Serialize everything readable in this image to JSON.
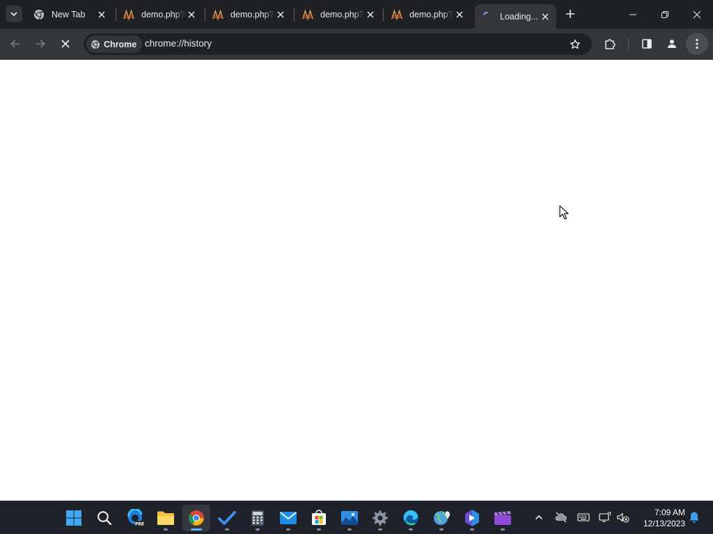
{
  "browser": {
    "tabs": [
      {
        "title": "New Tab",
        "favicon": "chrome-icon",
        "active": false
      },
      {
        "title": "demo.php?",
        "favicon": "opencart-icon",
        "active": false
      },
      {
        "title": "demo.php?",
        "favicon": "opencart-icon",
        "active": false
      },
      {
        "title": "demo.php?",
        "favicon": "opencart-icon",
        "active": false
      },
      {
        "title": "demo.php?",
        "favicon": "opencart-icon",
        "active": false
      },
      {
        "title": "Loading...",
        "favicon": "loading-spinner-icon",
        "active": true
      }
    ],
    "toolbar": {
      "chip_label": "Chrome",
      "url": "chrome://history",
      "reload_state": "stop"
    }
  },
  "taskbar": {
    "apps": [
      {
        "name": "start",
        "icon": "windows-start-icon"
      },
      {
        "name": "search",
        "icon": "search-icon"
      },
      {
        "name": "edge-dev",
        "icon": "edge-pre-icon"
      },
      {
        "name": "file-explorer",
        "icon": "folder-icon"
      },
      {
        "name": "chrome",
        "icon": "chrome-icon",
        "active": true
      },
      {
        "name": "todo",
        "icon": "todo-check-icon"
      },
      {
        "name": "calculator",
        "icon": "calculator-icon"
      },
      {
        "name": "mail",
        "icon": "mail-icon"
      },
      {
        "name": "store",
        "icon": "store-icon"
      },
      {
        "name": "photos",
        "icon": "photos-icon"
      },
      {
        "name": "settings",
        "icon": "settings-gear-icon"
      },
      {
        "name": "edge",
        "icon": "edge-icon"
      },
      {
        "name": "maps",
        "icon": "maps-icon"
      },
      {
        "name": "bing",
        "icon": "bing-icon"
      },
      {
        "name": "clipchamp",
        "icon": "clipchamp-icon"
      }
    ],
    "clock": {
      "time": "7:09 AM",
      "date": "12/13/2023"
    }
  },
  "colors": {
    "tabstrip_bg": "#202124",
    "toolbar_bg": "#35363a",
    "taskbar_bg": "#1f2228",
    "active_indicator": "#5eb3f5"
  }
}
